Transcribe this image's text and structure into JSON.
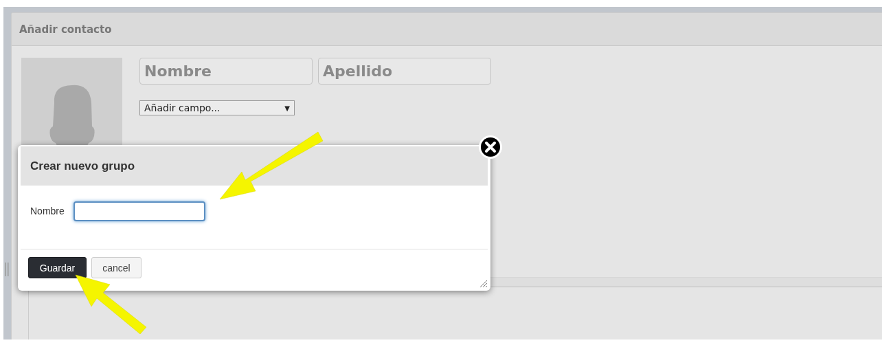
{
  "panel": {
    "title": "Añadir contacto",
    "first_name": {
      "placeholder": "Nombre"
    },
    "last_name": {
      "placeholder": "Apellido"
    },
    "add_field": {
      "value": "Añadir campo...",
      "caret": "▼"
    }
  },
  "dialog": {
    "title": "Crear nuevo grupo",
    "field": {
      "label": "Nombre",
      "focused": true
    },
    "buttons": [
      {
        "label": "Guardar",
        "kind": "primary"
      },
      {
        "label": "cancel",
        "kind": "secondary"
      }
    ]
  }
}
